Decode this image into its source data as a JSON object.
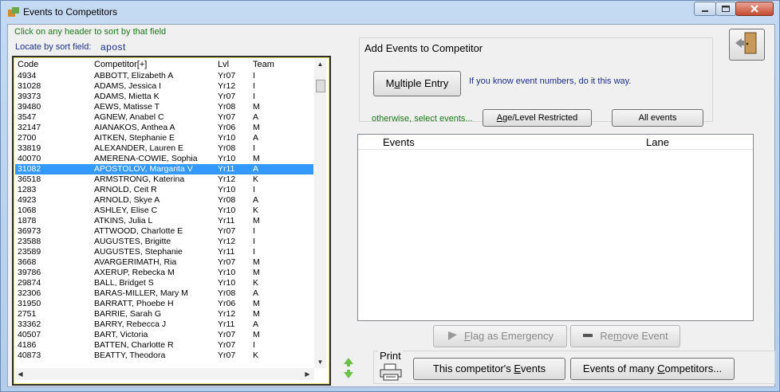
{
  "window": {
    "title": "Events to Competitors"
  },
  "hints": {
    "header_sort": "Click on any header to sort by that field",
    "locate_label": "Locate by sort field:"
  },
  "locate": {
    "value": "apost"
  },
  "list": {
    "headers": {
      "code": "Code",
      "competitor": "Competitor[+]",
      "lvl": "Lvl",
      "team": "Team"
    },
    "rows": [
      {
        "code": "4934",
        "name": "ABBOTT, Elizabeth A",
        "lvl": "Yr07",
        "team": "I"
      },
      {
        "code": "31028",
        "name": "ADAMS, Jessica I",
        "lvl": "Yr12",
        "team": "I"
      },
      {
        "code": "39373",
        "name": "ADAMS, Mietta K",
        "lvl": "Yr07",
        "team": "I"
      },
      {
        "code": "39480",
        "name": "AEWS, Matisse T",
        "lvl": "Yr08",
        "team": "M"
      },
      {
        "code": "3547",
        "name": "AGNEW, Anabel C",
        "lvl": "Yr07",
        "team": "A"
      },
      {
        "code": "32147",
        "name": "AIANAKOS, Anthea A",
        "lvl": "Yr06",
        "team": "M"
      },
      {
        "code": "2700",
        "name": "AITKEN, Stephanie E",
        "lvl": "Yr10",
        "team": "A"
      },
      {
        "code": "33819",
        "name": "ALEXANDER, Lauren E",
        "lvl": "Yr08",
        "team": "I"
      },
      {
        "code": "40070",
        "name": "AMERENA-COWIE, Sophia",
        "lvl": "Yr10",
        "team": "M"
      },
      {
        "code": "31082",
        "name": "APOSTOLOV, Margarita V",
        "lvl": "Yr11",
        "team": "A"
      },
      {
        "code": "36518",
        "name": "ARMSTRONG, Katerina",
        "lvl": "Yr12",
        "team": "K"
      },
      {
        "code": "1283",
        "name": "ARNOLD, Ceit R",
        "lvl": "Yr10",
        "team": "I"
      },
      {
        "code": "4923",
        "name": "ARNOLD, Skye A",
        "lvl": "Yr08",
        "team": "A"
      },
      {
        "code": "1068",
        "name": "ASHLEY, Elise C",
        "lvl": "Yr10",
        "team": "K"
      },
      {
        "code": "1878",
        "name": "ATKINS, Julia L",
        "lvl": "Yr11",
        "team": "M"
      },
      {
        "code": "36973",
        "name": "ATTWOOD, Charlotte E",
        "lvl": "Yr07",
        "team": "I"
      },
      {
        "code": "23588",
        "name": "AUGUSTES, Brigitte",
        "lvl": "Yr12",
        "team": "I"
      },
      {
        "code": "23589",
        "name": "AUGUSTES, Stephanie",
        "lvl": "Yr11",
        "team": "I"
      },
      {
        "code": "3668",
        "name": "AVARGERIMATH, Ria",
        "lvl": "Yr07",
        "team": "M"
      },
      {
        "code": "39786",
        "name": "AXERUP, Rebecka M",
        "lvl": "Yr10",
        "team": "M"
      },
      {
        "code": "29874",
        "name": "BALL, Bridget S",
        "lvl": "Yr10",
        "team": "K"
      },
      {
        "code": "32306",
        "name": "BARAS-MILLER, Mary M",
        "lvl": "Yr08",
        "team": "A"
      },
      {
        "code": "31950",
        "name": "BARRATT, Phoebe H",
        "lvl": "Yr06",
        "team": "M"
      },
      {
        "code": "2751",
        "name": "BARRIE, Sarah G",
        "lvl": "Yr12",
        "team": "M"
      },
      {
        "code": "33362",
        "name": "BARRY, Rebecca J",
        "lvl": "Yr11",
        "team": "A"
      },
      {
        "code": "40507",
        "name": "BART, Victoria",
        "lvl": "Yr07",
        "team": "M"
      },
      {
        "code": "4186",
        "name": "BATTEN, Charlotte R",
        "lvl": "Yr07",
        "team": "I"
      },
      {
        "code": "40873",
        "name": "BEATTY, Theodora",
        "lvl": "Yr07",
        "team": "K"
      }
    ],
    "selected_index": 9
  },
  "add_group": {
    "title": "Add Events to Competitor",
    "multiple_entry_pre": "M",
    "multiple_entry_u": "u",
    "multiple_entry_post": "ltiple Entry",
    "know_hint": "If you know event numbers, do it this way.",
    "otherwise_hint": "otherwise, select events...",
    "age_u": "A",
    "age_post": "ge/Level Restricted",
    "all_events": "All events"
  },
  "events_grid": {
    "headers": {
      "events": "Events",
      "lane": "Lane"
    }
  },
  "actions": {
    "flag_u": "F",
    "flag_post": "lag as Emergency",
    "remove_pre": "Re",
    "remove_u": "m",
    "remove_post": "ove Event"
  },
  "print_group": {
    "title": "Print",
    "this_pre": "This competitor's ",
    "this_u": "E",
    "this_post": "vents",
    "many_pre": "Events of many ",
    "many_u": "C",
    "many_post": "ompetitors..."
  },
  "colors": {
    "selection": "#3399ff",
    "hint_green": "#1b7a1b",
    "hint_blue": "#1c2f8a"
  }
}
